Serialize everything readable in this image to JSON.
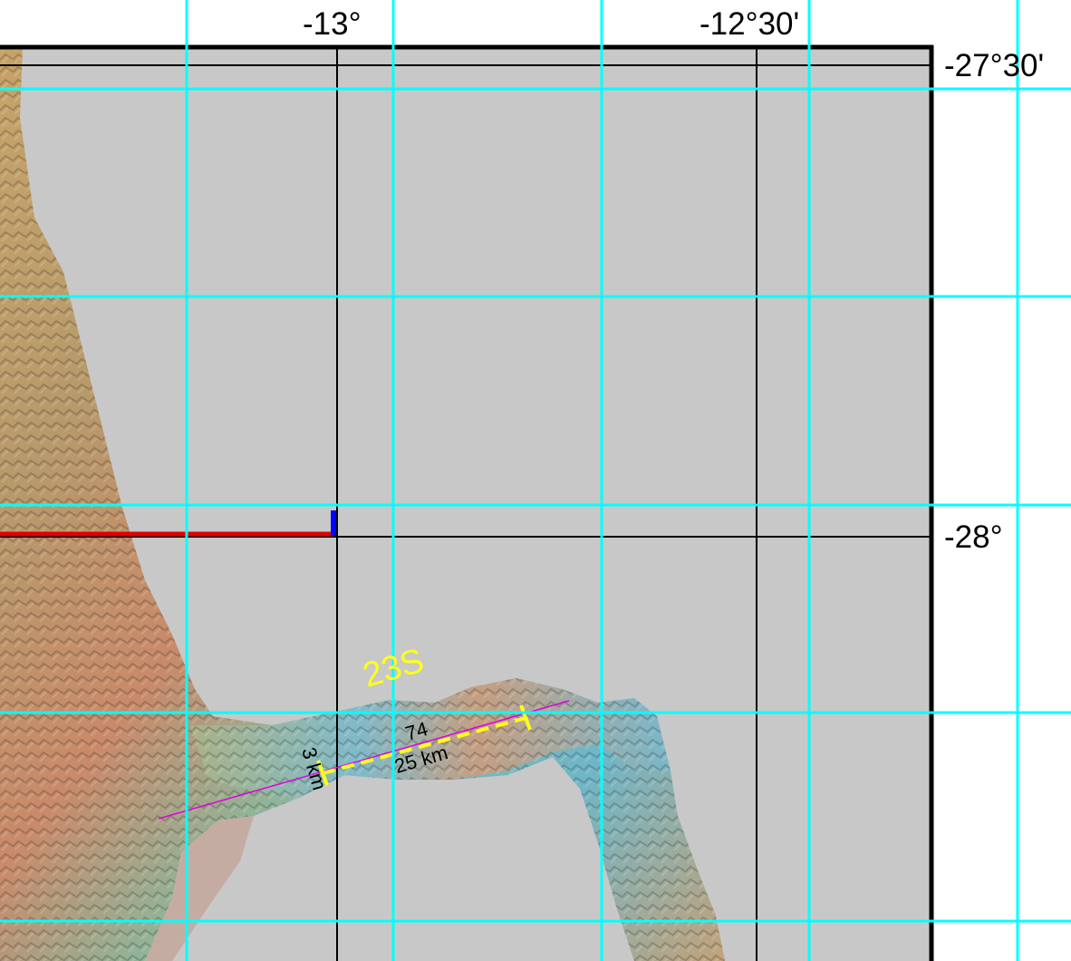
{
  "map": {
    "longitude_labels": [
      "-13°",
      "-12°30'"
    ],
    "latitude_labels": [
      "-27°30'",
      "-28°"
    ],
    "feature_label": "23S",
    "segment_label": "74",
    "length_label": "25 km",
    "width_label": "3 km",
    "colors": {
      "background_land": "#c8c8c8",
      "grid_overlay": "#00ffff",
      "frame": "#000000",
      "ship_track": "#e00000",
      "track_end": "#0000ff",
      "segment": "#ffff1a",
      "profile_line": "#e000e0"
    }
  }
}
